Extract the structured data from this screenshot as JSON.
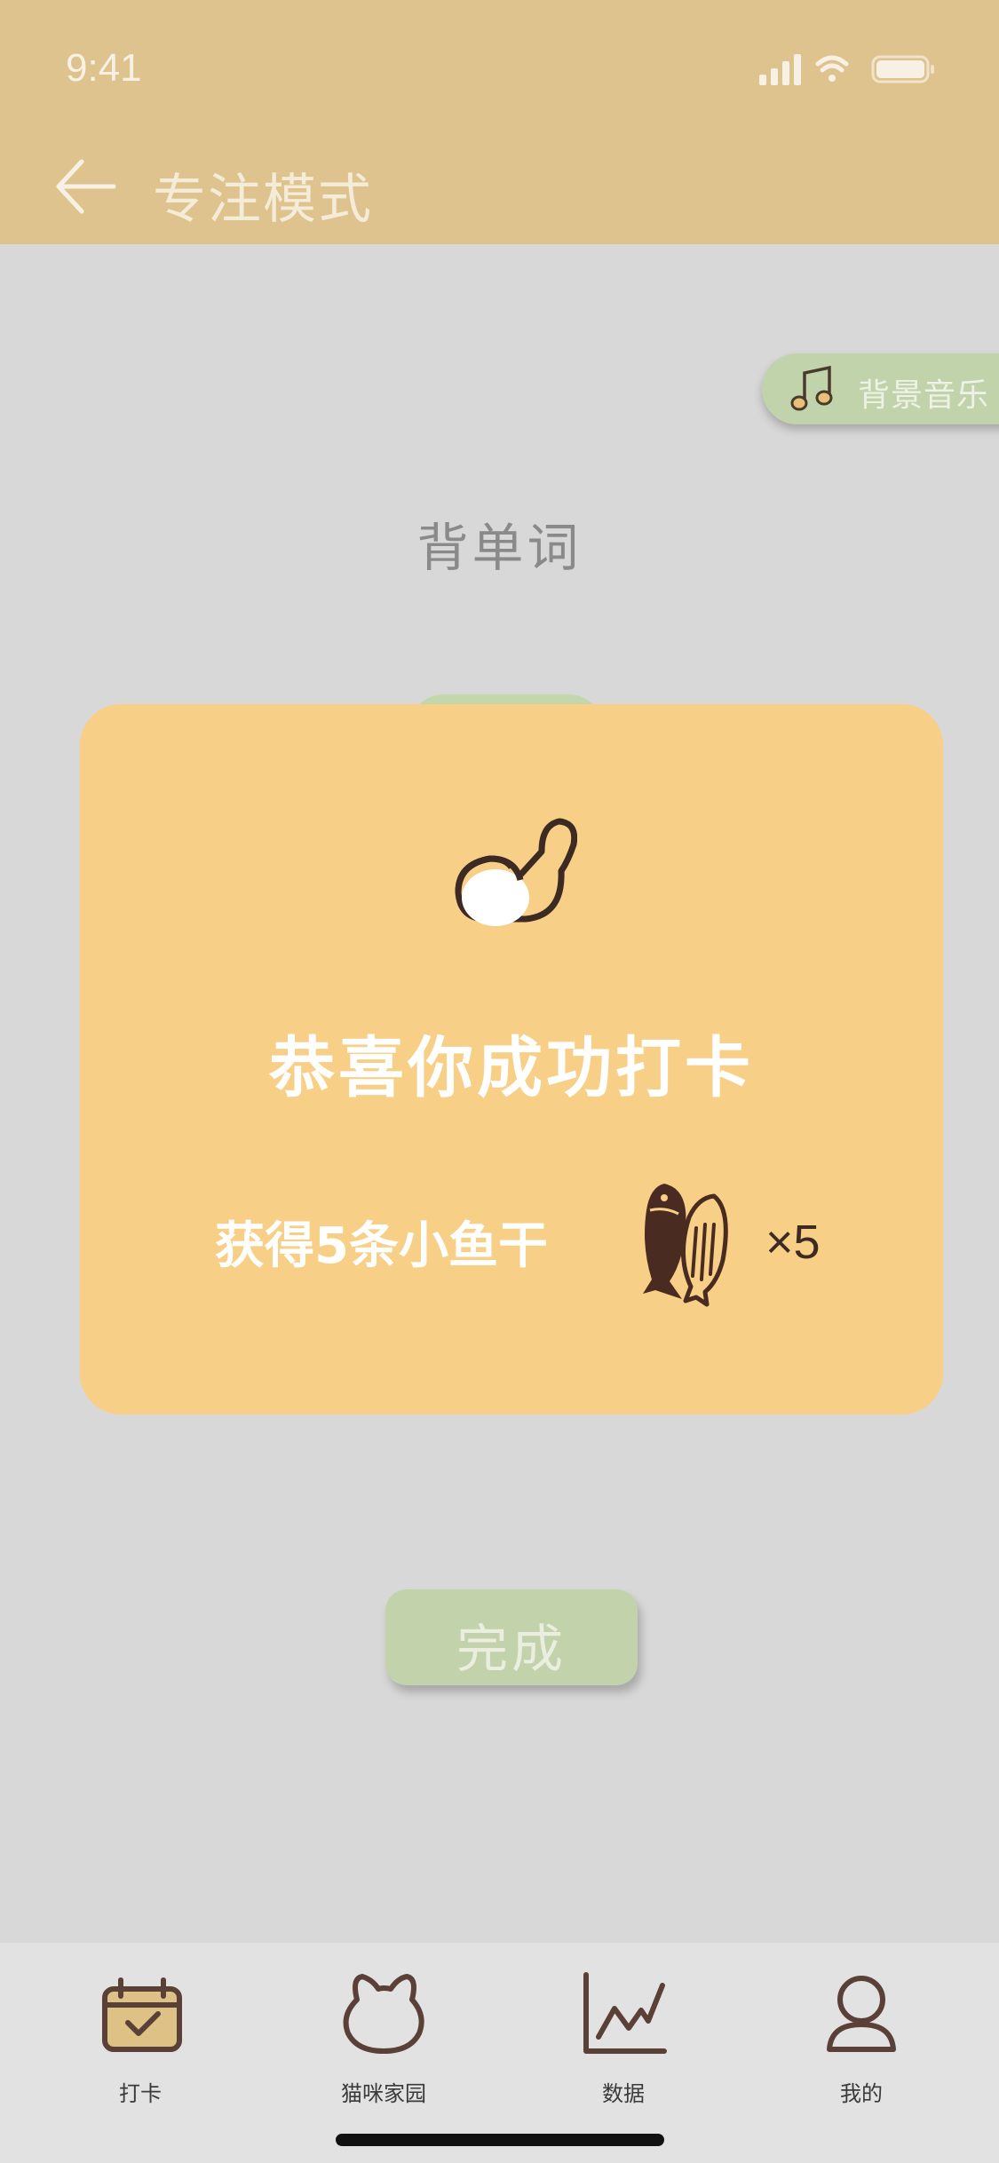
{
  "status_bar": {
    "time": "9:41"
  },
  "header": {
    "title": "专注模式"
  },
  "music": {
    "label": "背景音乐"
  },
  "task": {
    "name": "背单词"
  },
  "modal": {
    "title": "恭喜你成功打卡",
    "reward_text": "获得5条小鱼干",
    "multiplier": "×5"
  },
  "done_button": {
    "label": "完成"
  },
  "tabbar": {
    "items": [
      {
        "label": "打卡",
        "icon": "calendar-check-icon"
      },
      {
        "label": "猫咪家园",
        "icon": "cat-head-icon"
      },
      {
        "label": "数据",
        "icon": "chart-icon"
      },
      {
        "label": "我的",
        "icon": "user-icon"
      }
    ]
  },
  "colors": {
    "header": "#dfc38e",
    "modal": "#f7cf86",
    "accent_green": "#c2d3ab",
    "background": "#d8d8d8",
    "icon_brown": "#4a3028"
  }
}
